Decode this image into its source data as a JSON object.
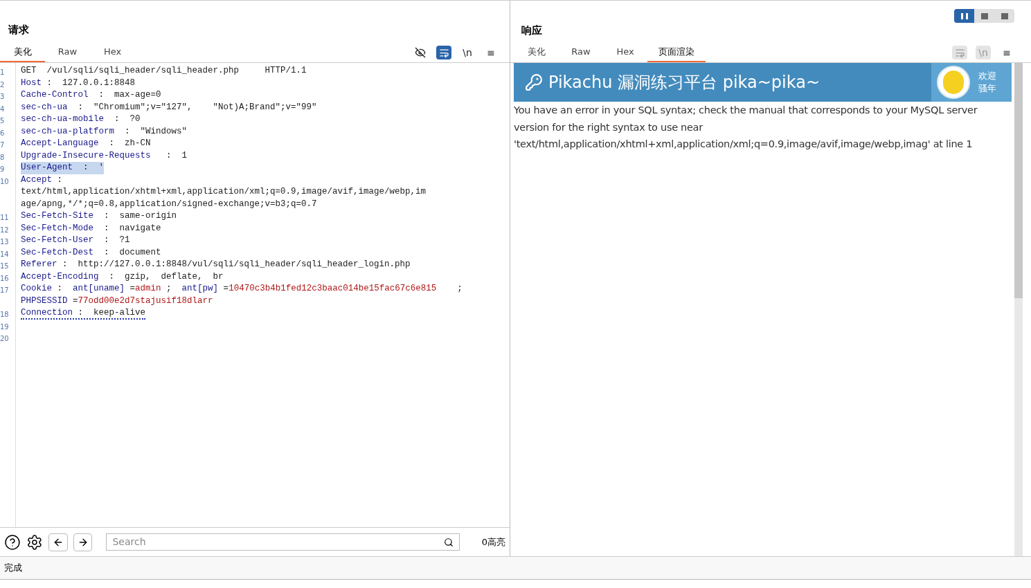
{
  "layout_toggles": [
    {
      "selected": true
    },
    {
      "selected": false
    },
    {
      "selected": false
    }
  ],
  "request": {
    "title": "请求",
    "tabs": [
      {
        "label": "美化",
        "selected": true
      },
      {
        "label": "Raw",
        "selected": false
      },
      {
        "label": "Hex",
        "selected": false
      }
    ],
    "toolbar": [
      {
        "kind": "hide",
        "selected": false
      },
      {
        "kind": "wrap",
        "selected": true
      },
      {
        "kind": "newline",
        "label": "\\n",
        "selected": false
      },
      {
        "kind": "menu",
        "label": "≡",
        "selected": false
      }
    ],
    "rows": [
      {
        "number": "1",
        "selected": false,
        "underlined": false,
        "segments": [
          {
            "kind": "text",
            "text": "GET  /vul/sqli/sqli_header/sqli_header.php     HTTP/1.1"
          }
        ]
      },
      {
        "number": "2",
        "selected": false,
        "underlined": false,
        "segments": [
          {
            "kind": "key",
            "text": "Host"
          },
          {
            "kind": "text",
            "text": " :  127.0.0.1:8848"
          }
        ]
      },
      {
        "number": "3",
        "selected": false,
        "underlined": false,
        "segments": [
          {
            "kind": "key",
            "text": "Cache-Control"
          },
          {
            "kind": "text",
            "text": "  :  max-age=0"
          }
        ]
      },
      {
        "number": "4",
        "selected": false,
        "underlined": false,
        "segments": [
          {
            "kind": "key",
            "text": "sec-ch-ua"
          },
          {
            "kind": "text",
            "text": "  :  \"Chromium\";v=\"127\",    \"Not)A;Brand\";v=\"99\""
          }
        ]
      },
      {
        "number": "5",
        "selected": false,
        "underlined": false,
        "segments": [
          {
            "kind": "key",
            "text": "sec-ch-ua-mobile"
          },
          {
            "kind": "text",
            "text": "  :  ?0"
          }
        ]
      },
      {
        "number": "6",
        "selected": false,
        "underlined": false,
        "segments": [
          {
            "kind": "key",
            "text": "sec-ch-ua-platform"
          },
          {
            "kind": "text",
            "text": "  :  \"Windows\""
          }
        ]
      },
      {
        "number": "7",
        "selected": false,
        "underlined": false,
        "segments": [
          {
            "kind": "key",
            "text": "Accept-Language"
          },
          {
            "kind": "text",
            "text": "  :  zh-CN"
          }
        ]
      },
      {
        "number": "8",
        "selected": false,
        "underlined": false,
        "segments": [
          {
            "kind": "key",
            "text": "Upgrade-Insecure-Requests"
          },
          {
            "kind": "text",
            "text": "   :  1"
          }
        ]
      },
      {
        "number": "9",
        "selected": true,
        "underlined": false,
        "segments": [
          {
            "kind": "key",
            "text": "User-Agent"
          },
          {
            "kind": "text",
            "text": "  :  '"
          }
        ]
      },
      {
        "number": "10",
        "selected": false,
        "underlined": false,
        "segments": [
          {
            "kind": "key",
            "text": "Accept"
          },
          {
            "kind": "text",
            "text": " :"
          }
        ]
      },
      {
        "selected": false,
        "underlined": false,
        "segments": [
          {
            "kind": "text",
            "text": "text/html,application/xhtml+xml,application/xml;q=0.9,image/avif,image/webp,im"
          }
        ]
      },
      {
        "selected": false,
        "underlined": false,
        "segments": [
          {
            "kind": "text",
            "text": "age/apng,*/*;q=0.8,application/signed-exchange;v=b3;q=0.7"
          }
        ]
      },
      {
        "number": "11",
        "selected": false,
        "underlined": false,
        "segments": [
          {
            "kind": "key",
            "text": "Sec-Fetch-Site"
          },
          {
            "kind": "text",
            "text": "  :  same-origin"
          }
        ]
      },
      {
        "number": "12",
        "selected": false,
        "underlined": false,
        "segments": [
          {
            "kind": "key",
            "text": "Sec-Fetch-Mode"
          },
          {
            "kind": "text",
            "text": "  :  navigate"
          }
        ]
      },
      {
        "number": "13",
        "selected": false,
        "underlined": false,
        "segments": [
          {
            "kind": "key",
            "text": "Sec-Fetch-User"
          },
          {
            "kind": "text",
            "text": "  :  ?1"
          }
        ]
      },
      {
        "number": "14",
        "selected": false,
        "underlined": false,
        "segments": [
          {
            "kind": "key",
            "text": "Sec-Fetch-Dest"
          },
          {
            "kind": "text",
            "text": "  :  document"
          }
        ]
      },
      {
        "number": "15",
        "selected": false,
        "underlined": false,
        "segments": [
          {
            "kind": "key",
            "text": "Referer"
          },
          {
            "kind": "text",
            "text": " :  http://127.0.0.1:8848/vul/sqli/sqli_header/sqli_header_login.php"
          }
        ]
      },
      {
        "number": "16",
        "selected": false,
        "underlined": false,
        "segments": [
          {
            "kind": "key",
            "text": "Accept-Encoding"
          },
          {
            "kind": "text",
            "text": "  :  gzip,  deflate,  br"
          }
        ]
      },
      {
        "number": "17",
        "selected": false,
        "underlined": false,
        "segments": [
          {
            "kind": "key",
            "text": "Cookie"
          },
          {
            "kind": "text",
            "text": " :  "
          },
          {
            "kind": "key",
            "text": "ant[uname]"
          },
          {
            "kind": "text",
            "text": " ="
          },
          {
            "kind": "value",
            "text": "admin"
          },
          {
            "kind": "text",
            "text": " ;  "
          },
          {
            "kind": "key",
            "text": "ant[pw]"
          },
          {
            "kind": "text",
            "text": " ="
          },
          {
            "kind": "value",
            "text": "10470c3b4b1fed12c3baac014be15fac67c6e815"
          },
          {
            "kind": "text",
            "text": "    ;"
          }
        ]
      },
      {
        "selected": false,
        "underlined": false,
        "segments": [
          {
            "kind": "key",
            "text": "PHPSESSID"
          },
          {
            "kind": "text",
            "text": " ="
          },
          {
            "kind": "value",
            "text": "77odd00e2d7stajusif18dlarr"
          }
        ]
      },
      {
        "number": "18",
        "selected": false,
        "underlined": true,
        "segments": [
          {
            "kind": "key",
            "text": "Connection"
          },
          {
            "kind": "text",
            "text": " :  keep-alive"
          }
        ]
      },
      {
        "number": "19",
        "selected": false,
        "underlined": false,
        "segments": []
      },
      {
        "number": "20",
        "selected": false,
        "underlined": false,
        "segments": []
      }
    ],
    "search": {
      "placeholder": "Search"
    },
    "highlights": "0高亮"
  },
  "response": {
    "title": "响应",
    "tabs": [
      {
        "label": "美化",
        "selected": false
      },
      {
        "label": "Raw",
        "selected": false
      },
      {
        "label": "Hex",
        "selected": false
      },
      {
        "label": "页面渲染",
        "selected": true
      }
    ],
    "toolbar": [
      {
        "kind": "wrap",
        "selected": false
      },
      {
        "kind": "newline",
        "label": "\\n",
        "selected": false
      },
      {
        "kind": "menu",
        "label": "≡",
        "selected": false
      }
    ],
    "banner": {
      "title": "Pikachu 漏洞练习平台 pika~pika~",
      "greeting": [
        "欢迎",
        "骚年"
      ]
    },
    "message": "You have an error in your SQL syntax; check the manual that corresponds to your MySQL server version for the right syntax to use near 'text/html,application/xhtml+xml,application/xml;q=0.9,image/avif,image/webp,imag' at line 1"
  },
  "status_bar": "完成"
}
